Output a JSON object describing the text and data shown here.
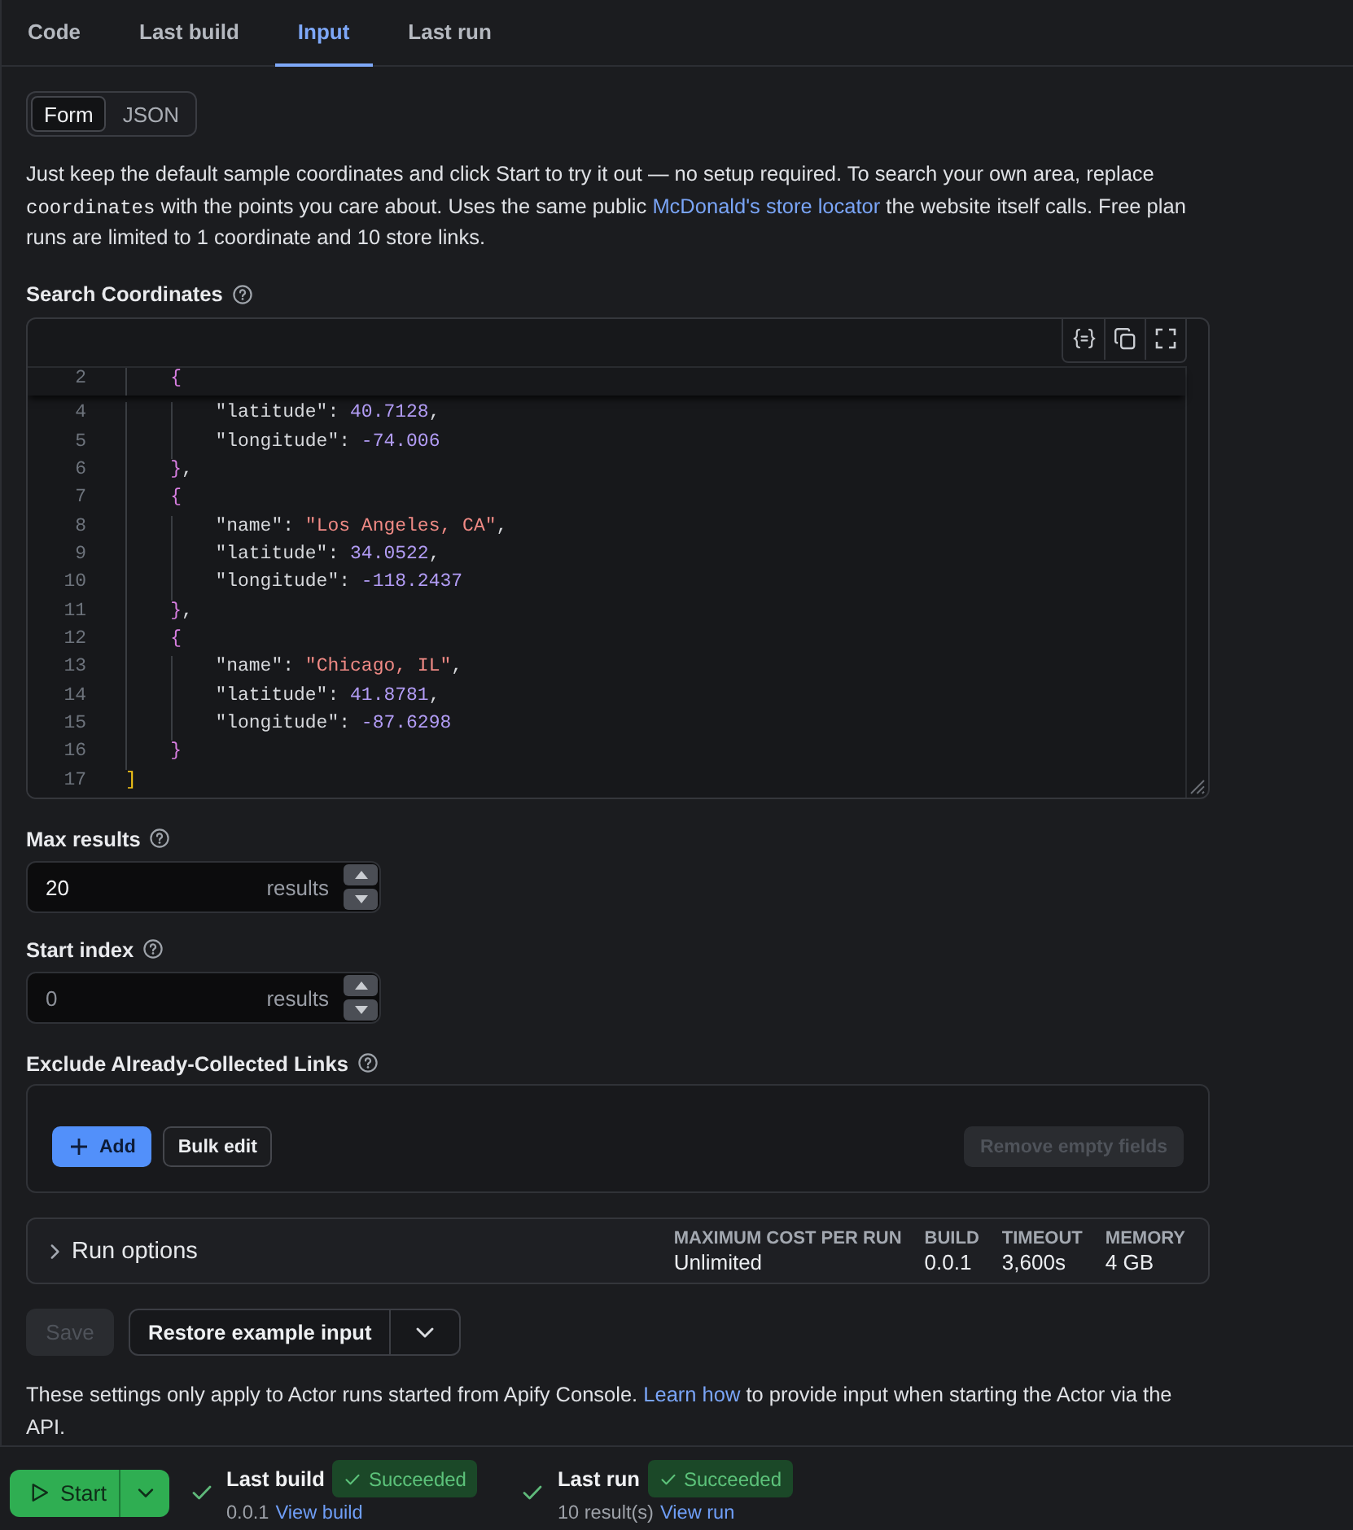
{
  "tabs": [
    {
      "label": "Code",
      "selected": false
    },
    {
      "label": "Last build",
      "selected": false
    },
    {
      "label": "Input",
      "selected": true
    },
    {
      "label": "Last run",
      "selected": false
    }
  ],
  "mode_toggle": [
    {
      "label": "Form",
      "selected": true
    },
    {
      "label": "JSON",
      "selected": false
    }
  ],
  "description": [
    {
      "kind": "text",
      "text": "Just keep the default sample coordinates and click Start to try it out — no setup required. To search your own area, replace "
    },
    {
      "kind": "code",
      "text": "coordinates"
    },
    {
      "kind": "text",
      "text": " with the points you care about. Uses the same public "
    },
    {
      "kind": "link",
      "text": "McDonald's store locator"
    },
    {
      "kind": "text",
      "text": " the website itself calls. Free plan runs are limited to 1 coordinate and 10 store links."
    }
  ],
  "search_coordinates": {
    "label": "Search Coordinates",
    "editor": {
      "sticky_header": true,
      "lines": [
        {
          "number": "2",
          "tokens": [
            {
              "kind": "brace",
              "text": "{"
            }
          ],
          "children": [
            {
              "number": "4",
              "tokens": [
                {
                  "kind": "key",
                  "text": "\"latitude\""
                },
                {
                  "kind": "punct",
                  "text": ": "
                },
                {
                  "kind": "number",
                  "text": "40.7128"
                },
                {
                  "kind": "punct",
                  "text": ","
                }
              ]
            },
            {
              "number": "5",
              "tokens": [
                {
                  "kind": "key",
                  "text": "\"longitude\""
                },
                {
                  "kind": "punct",
                  "text": ": "
                },
                {
                  "kind": "number",
                  "text": "-74.006"
                }
              ]
            }
          ]
        },
        {
          "number": "6",
          "tokens": [
            {
              "kind": "brace",
              "text": "}"
            },
            {
              "kind": "punct",
              "text": ","
            }
          ]
        },
        {
          "number": "7",
          "tokens": [
            {
              "kind": "brace",
              "text": "{"
            }
          ],
          "children": [
            {
              "number": "8",
              "tokens": [
                {
                  "kind": "key",
                  "text": "\"name\""
                },
                {
                  "kind": "punct",
                  "text": ": "
                },
                {
                  "kind": "string",
                  "text": "\"Los Angeles, CA\""
                },
                {
                  "kind": "punct",
                  "text": ","
                }
              ]
            },
            {
              "number": "9",
              "tokens": [
                {
                  "kind": "key",
                  "text": "\"latitude\""
                },
                {
                  "kind": "punct",
                  "text": ": "
                },
                {
                  "kind": "number",
                  "text": "34.0522"
                },
                {
                  "kind": "punct",
                  "text": ","
                }
              ]
            },
            {
              "number": "10",
              "tokens": [
                {
                  "kind": "key",
                  "text": "\"longitude\""
                },
                {
                  "kind": "punct",
                  "text": ": "
                },
                {
                  "kind": "number",
                  "text": "-118.2437"
                }
              ]
            }
          ]
        },
        {
          "number": "11",
          "tokens": [
            {
              "kind": "brace",
              "text": "}"
            },
            {
              "kind": "punct",
              "text": ","
            }
          ]
        },
        {
          "number": "12",
          "tokens": [
            {
              "kind": "brace",
              "text": "{"
            }
          ],
          "children": [
            {
              "number": "13",
              "tokens": [
                {
                  "kind": "key",
                  "text": "\"name\""
                },
                {
                  "kind": "punct",
                  "text": ": "
                },
                {
                  "kind": "string",
                  "text": "\"Chicago, IL\""
                },
                {
                  "kind": "punct",
                  "text": ","
                }
              ]
            },
            {
              "number": "14",
              "tokens": [
                {
                  "kind": "key",
                  "text": "\"latitude\""
                },
                {
                  "kind": "punct",
                  "text": ": "
                },
                {
                  "kind": "number",
                  "text": "41.8781"
                },
                {
                  "kind": "punct",
                  "text": ","
                }
              ]
            },
            {
              "number": "15",
              "tokens": [
                {
                  "kind": "key",
                  "text": "\"longitude\""
                },
                {
                  "kind": "punct",
                  "text": ": "
                },
                {
                  "kind": "number",
                  "text": "-87.6298"
                }
              ]
            }
          ]
        },
        {
          "number": "16",
          "tokens": [
            {
              "kind": "brace",
              "text": "}"
            }
          ]
        }
      ],
      "closing_line": {
        "number": "17",
        "tokens": [
          {
            "kind": "bracket",
            "text": "]"
          }
        ]
      }
    }
  },
  "max_results": {
    "label": "Max results",
    "value": "20",
    "unit": "results"
  },
  "start_index": {
    "label": "Start index",
    "placeholder": "0",
    "unit": "results"
  },
  "exclude_links": {
    "label": "Exclude Already-Collected Links",
    "buttons": [
      {
        "label": "Add",
        "kind": "primary",
        "disabled": false
      },
      {
        "label": "Bulk edit",
        "kind": "secondary",
        "disabled": false
      },
      {
        "label": "Remove empty fields",
        "kind": "secondary",
        "disabled": true
      }
    ]
  },
  "run_options": {
    "label": "Run options",
    "expanded": false,
    "stats": [
      {
        "label": "MAXIMUM COST PER RUN",
        "value": "Unlimited"
      },
      {
        "label": "BUILD",
        "value": "0.0.1"
      },
      {
        "label": "TIMEOUT",
        "value": "3,600s"
      },
      {
        "label": "MEMORY",
        "value": "4 GB"
      }
    ]
  },
  "actions": {
    "save": {
      "label": "Save",
      "disabled": true
    },
    "restore": {
      "label": "Restore example input"
    }
  },
  "note": [
    {
      "kind": "text",
      "text": "These settings only apply to Actor runs started from Apify Console. "
    },
    {
      "kind": "link",
      "text": "Learn how"
    },
    {
      "kind": "text",
      "text": " to provide input when starting the Actor via the API."
    }
  ],
  "bottom_bar": {
    "start_button": {
      "label": "Start"
    },
    "statuses": [
      {
        "label": "Last build",
        "status": "Succeeded",
        "kind": "success",
        "detail": "0.0.1",
        "link": "View build"
      },
      {
        "label": "Last run",
        "status": "Succeeded",
        "kind": "success",
        "detail": "10 result(s)",
        "link": "View run"
      }
    ]
  }
}
